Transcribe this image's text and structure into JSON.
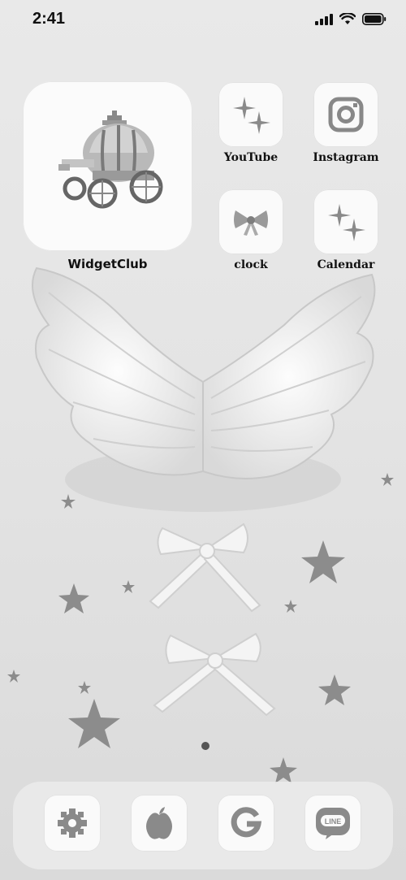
{
  "status_bar": {
    "time": "2:41"
  },
  "widget": {
    "label": "WidgetClub",
    "image": "pumpkin-carriage"
  },
  "apps": [
    {
      "label": "YouTube",
      "icon": "sparkles-icon"
    },
    {
      "label": "Instagram",
      "icon": "instagram-icon"
    },
    {
      "label": "clock",
      "icon": "ribbon-bow-icon"
    },
    {
      "label": "Calendar",
      "icon": "sparkles-icon"
    }
  ],
  "dock": [
    {
      "icon": "gear-icon"
    },
    {
      "icon": "apple-icon"
    },
    {
      "icon": "google-g-icon"
    },
    {
      "icon": "line-icon",
      "badge_text": "LINE"
    }
  ]
}
